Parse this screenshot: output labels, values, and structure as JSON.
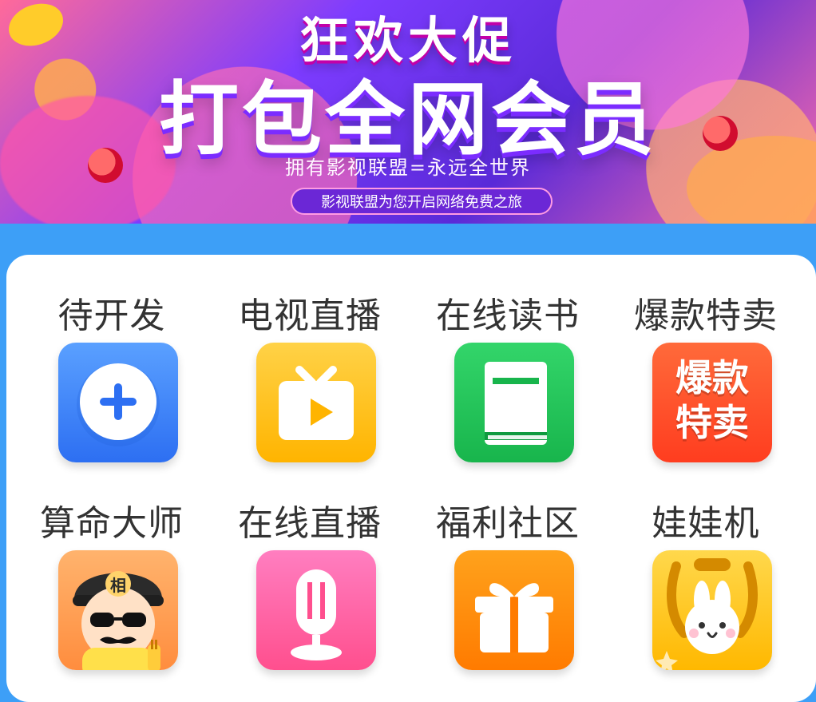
{
  "banner": {
    "title_small": "狂欢大促",
    "title_big": "打包全网会员",
    "subtitle": "拥有影视联盟=永远全世界",
    "pill": "影视联盟为您开启网络免费之旅"
  },
  "apps": [
    {
      "label": "待开发",
      "icon": "add-icon"
    },
    {
      "label": "电视直播",
      "icon": "tv-icon"
    },
    {
      "label": "在线读书",
      "icon": "book-icon"
    },
    {
      "label": "爆款特卖",
      "icon": "hot-sale-icon",
      "icon_text_line1": "爆款",
      "icon_text_line2": "特卖"
    },
    {
      "label": "算命大师",
      "icon": "fortune-master-icon",
      "badge_text": "相"
    },
    {
      "label": "在线直播",
      "icon": "microphone-icon"
    },
    {
      "label": "福利社区",
      "icon": "gift-icon"
    },
    {
      "label": "娃娃机",
      "icon": "claw-machine-icon"
    }
  ],
  "colors": {
    "page_bg": "#3d9ff7",
    "panel_bg": "#ffffff",
    "label_text": "#333333"
  }
}
